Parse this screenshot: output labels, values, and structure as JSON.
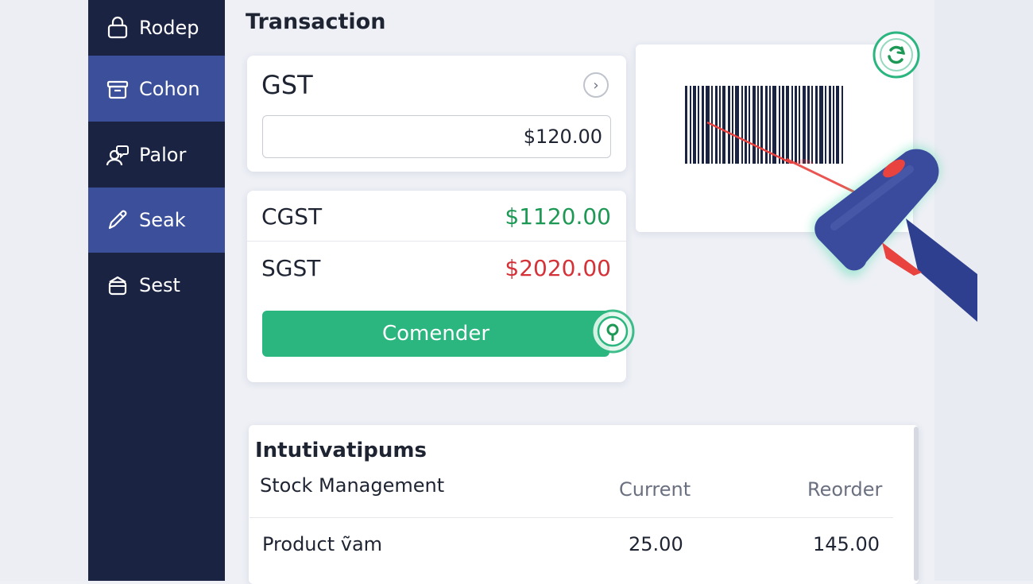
{
  "sidebar": {
    "items": [
      {
        "label": "Rodep",
        "icon": "lock-icon",
        "active": false
      },
      {
        "label": "Cohon",
        "icon": "package-icon",
        "active": true
      },
      {
        "label": "Palor",
        "icon": "user-chat-icon",
        "active": false
      },
      {
        "label": "Seak",
        "icon": "pencil-icon",
        "active": true
      },
      {
        "label": "Sest",
        "icon": "bag-icon",
        "active": false
      }
    ]
  },
  "page": {
    "title": "Transaction"
  },
  "gst": {
    "label": "GST",
    "amount": "$120.00",
    "chevron": "chevron-right-icon"
  },
  "taxes": [
    {
      "label": "CGST",
      "value": "$1120.00",
      "color": "#1e9955"
    },
    {
      "label": "SGST",
      "value": "$2020.00",
      "color": "#d43238"
    }
  ],
  "actions": {
    "confirm_label": "Comender"
  },
  "scanner": {
    "barcode_icon": "barcode-icon",
    "scanner_icon": "barcode-scanner-icon",
    "badge_icon": "refresh-icon"
  },
  "stock": {
    "title": "Intutivatipums",
    "subtitle": "Stock Management",
    "columns": {
      "current": "Current",
      "reorder": "Reorder"
    },
    "rows": [
      {
        "name": "Product ṽam",
        "current": "25.00",
        "reorder": "145.00"
      }
    ]
  },
  "colors": {
    "sidebar_bg": "#1b2343",
    "sidebar_active": "#3c4f9a",
    "accent_green": "#2bb67f",
    "scanner_blue": "#3a4a9c",
    "laser_red": "#e8433f"
  }
}
